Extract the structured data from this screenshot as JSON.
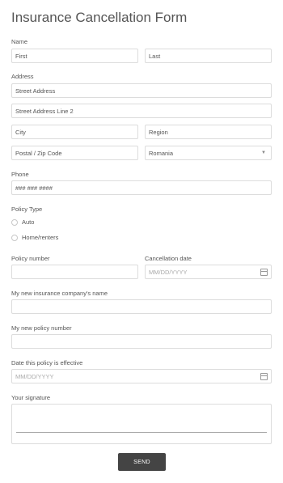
{
  "form": {
    "title": "Insurance Cancellation Form",
    "name": {
      "label": "Name",
      "first_placeholder": "First",
      "last_placeholder": "Last"
    },
    "address": {
      "label": "Address",
      "street_placeholder": "Street Address",
      "street2_placeholder": "Street Address Line 2",
      "city_placeholder": "City",
      "region_placeholder": "Region",
      "postal_placeholder": "Postal / Zip Code",
      "country_value": "Romania"
    },
    "phone": {
      "label": "Phone",
      "placeholder": "### ### ####"
    },
    "policy_type": {
      "label": "Policy Type",
      "options": [
        "Auto",
        "Home/renters"
      ]
    },
    "policy_number": {
      "label": "Policy number"
    },
    "cancellation_date": {
      "label": "Cancellation date",
      "placeholder": "MM/DD/YYYY"
    },
    "new_company": {
      "label": "My new insurance company's name"
    },
    "new_policy_number": {
      "label": "My new policy number"
    },
    "effective_date": {
      "label": "Date this policy is effective",
      "placeholder": "MM/DD/YYYY"
    },
    "signature": {
      "label": "Your signature"
    },
    "submit_label": "SEND"
  }
}
